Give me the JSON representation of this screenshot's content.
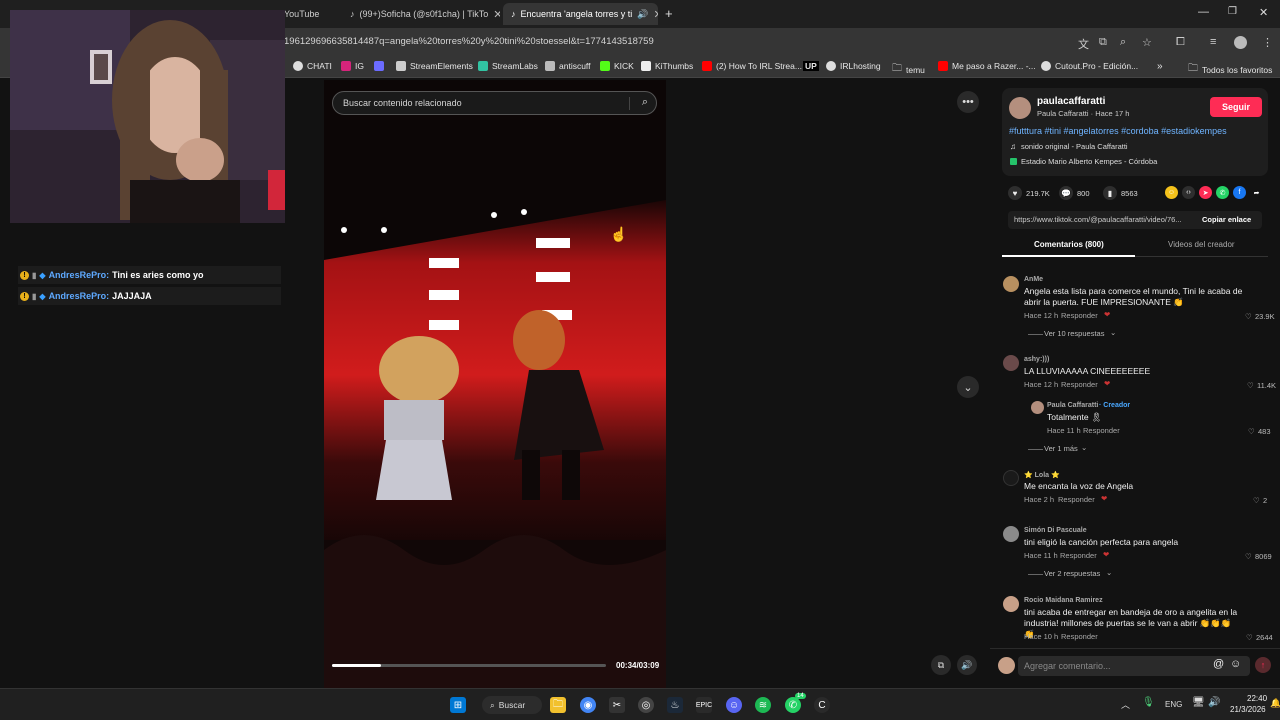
{
  "browser": {
    "tabs": [
      {
        "label": "YouTube"
      },
      {
        "label": "(99+)Soficha (@s0f1cha) | TikTo"
      },
      {
        "label": "Encuentra 'angela torres y ti"
      }
    ],
    "url": "196129696635814487q=angela%20torres%20y%20tini%20stoessel&t=1774143518759",
    "bookmarks": [
      {
        "label": "CHATI",
        "color": "#dddddd"
      },
      {
        "label": "IG",
        "color": "#d6247b"
      },
      {
        "label": "",
        "color": "#6b6bff"
      },
      {
        "label": "StreamElements",
        "color": "#cccccc"
      },
      {
        "label": "StreamLabs",
        "color": "#31c3a2"
      },
      {
        "label": "antiscuff",
        "color": "#bbbbbb"
      },
      {
        "label": "KICK",
        "color": "#53fc18"
      },
      {
        "label": "KiThumbs",
        "color": "#eeeeee"
      },
      {
        "label": "(2) How To IRL Strea...",
        "color": "#ff0000"
      },
      {
        "label": "UP",
        "color": "#000000"
      },
      {
        "label": "IRLhosting",
        "color": "#dddddd"
      },
      {
        "label": "temu",
        "color": "#aaaaaa"
      },
      {
        "label": "Me paso a Razer... -...",
        "color": "#ff0000"
      },
      {
        "label": "Cutout.Pro - Edición...",
        "color": "#dddddd"
      },
      {
        "label": "Todos los favoritos",
        "color": "#aaaaaa"
      }
    ]
  },
  "chat": [
    {
      "user": "AndresRePro:",
      "message": "Tini es aries como yo"
    },
    {
      "user": "AndresRePro:",
      "message": "JAJJAJA"
    }
  ],
  "video": {
    "search_placeholder": "Buscar contenido relacionado",
    "time": "00:34/03:09",
    "progress": 0.18
  },
  "post": {
    "author": "paulacaffaratti",
    "subtitle": "Paula Caffaratti · Hace 17 h",
    "follow_label": "Seguir",
    "hashtags": "#futttura #tini #angelatorres #cordoba #estadiokempes",
    "sound": "sonido original - Paula Caffaratti",
    "location": "Estadio Mario Alberto Kempes - Córdoba",
    "likes": "219.7K",
    "comments": "800",
    "saves": "8563",
    "link": "https://www.tiktok.com/@paulacaffaratti/video/76...",
    "copy_link_label": "Copiar enlace",
    "tab_comments": "Comentarios (800)",
    "tab_creator_videos": "Videos del creador"
  },
  "comments": [
    {
      "name": "AnMe",
      "text": "Angela esta lista para comerce el mundo, Tini le acaba de abrir la puerta. FUE IMPRESIONANTE 👏",
      "time": "Hace 12 h",
      "reply": "Responder",
      "likes": "23.9K",
      "more": "Ver 10 respuestas"
    },
    {
      "name": "ashy:)))",
      "text": "LA LLUVIAAAAA CINEEEEEEEE",
      "time": "Hace 12 h",
      "reply": "Responder",
      "likes": "11.4K",
      "more": ""
    },
    {
      "name": "Paula Caffaratti",
      "creator": "· Creador",
      "text": "Totalmente 🎗",
      "time": "Hace 11 h",
      "reply": "Responder",
      "likes": "483",
      "more": "Ver 1 más"
    },
    {
      "name": "⭐ Lola ⭐",
      "text": "Me encanta la voz de Angela",
      "time": "Hace 2 h",
      "reply": "Responder",
      "likes": "2",
      "more": ""
    },
    {
      "name": "Simón Di Pascuale",
      "text": "tini eligió la canción perfecta para angela",
      "time": "Hace 11 h",
      "reply": "Responder",
      "likes": "8069",
      "more": "Ver 2 respuestas"
    },
    {
      "name": "Rocio Maidana Ramirez",
      "text": "tini acaba de entregar en bandeja de oro a angelita en la industria! millones de puertas se le van a abrir 👏👏👏👏",
      "time": "Hace 10 h",
      "reply": "Responder",
      "likes": "2644",
      "more": ""
    }
  ],
  "comment_input_placeholder": "Agregar comentario...",
  "taskbar": {
    "search_label": "Buscar",
    "lang": "ENG",
    "time": "22:40",
    "date": "21/3/2026",
    "whatsapp_badge": "14"
  }
}
